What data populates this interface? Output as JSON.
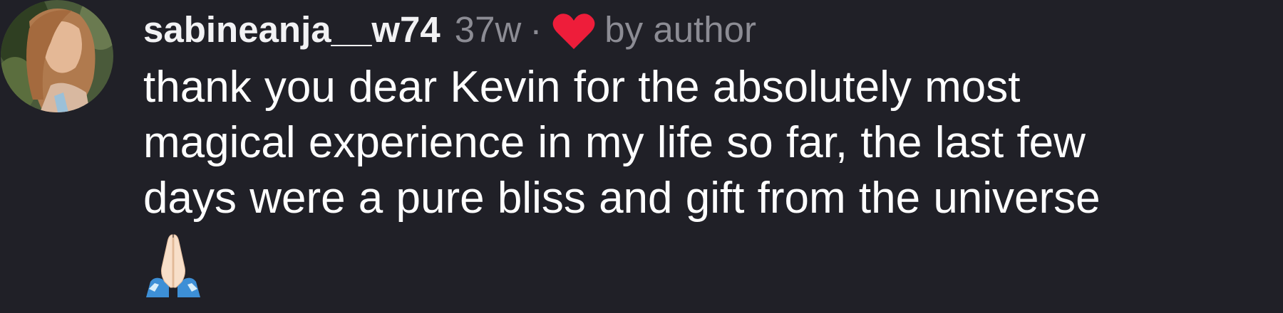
{
  "comment": {
    "username": "sabineanja__w74",
    "time": "37w",
    "separator": "·",
    "heart_icon": "heart-icon",
    "liked_by": "by author",
    "text_lines": [
      "thank you dear Kevin for the absolutely most",
      "magical experience in my life so far, the last few",
      "days were a pure bliss and gift from the universe"
    ],
    "emoji_icon": "folded-hands-icon"
  },
  "colors": {
    "background": "#202027",
    "text": "#ffffff",
    "muted": "#8c8c94",
    "heart": "#ee1d3a"
  }
}
